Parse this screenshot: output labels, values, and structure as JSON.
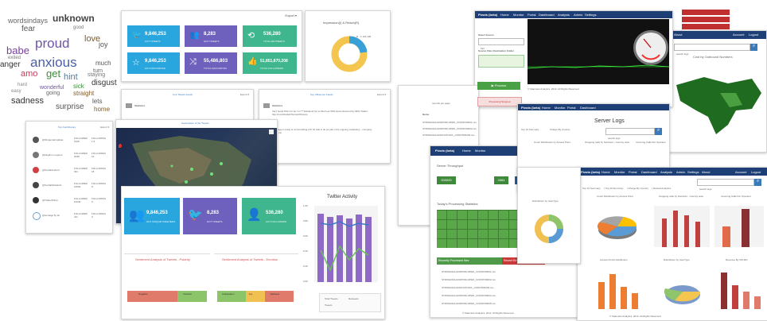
{
  "wordcloud": {
    "words": [
      "wordsindays",
      "unknown",
      "fear",
      "love",
      "proud",
      "babe",
      "anxious",
      "joy",
      "exited",
      "anger",
      "amo",
      "get",
      "hint",
      "much",
      "disgust",
      "turn",
      "staying",
      "sadness",
      "straight",
      "day",
      "lets",
      "surprise",
      "home",
      "sick",
      "wonderful",
      "going",
      "hard",
      "easy",
      "good"
    ]
  },
  "dashboard": {
    "export_label": "Export ▾",
    "tiles": [
      {
        "value": "9,846,253",
        "caption": "HOT TWEETS",
        "color": "#29a6dd"
      },
      {
        "value": "8,283",
        "caption": "HOT TWEETS",
        "color": "#6e60bd"
      },
      {
        "value": "536,280",
        "caption": "TOTAL RETWEETS",
        "color": "#3fb68e"
      },
      {
        "value": "9,846,253",
        "caption": "HOT FAVOURITES",
        "color": "#29a6dd"
      },
      {
        "value": "55,486,803",
        "caption": "TOTAL FAVOURITES",
        "color": "#6e60bd"
      },
      {
        "value": "51,851,870,208",
        "caption": "TOTAL FOLLOWERS",
        "color": "#3fb68e"
      }
    ],
    "donut_title": "Impression(I) & Reach(R)",
    "donut_label": "R - 1,101,1##",
    "live_tweets_title": "Live Tweets Feeds",
    "key_influencer_title": "Key Influencer Feeds",
    "user1": "Statistics",
    "user2": "Statistics",
    "tweet1": "Very Good Pick On: Ex 1-1™ Weekend Up to Much as 30% Here! Ensured by 90% Twitter. http://t.co/AbcdeF/SomeURLHere",
    "tweet2": "Leverage it ready is commanding 2.0/ 10 ads in do as part of its ongoing marketing... company outlet inc.",
    "top_influencer_title": "Top Contributors",
    "influencers": [
      {
        "name": "@thingenderupdate",
        "followers": "FOLLOWER 1328",
        "following": "FOLLOWING 1.6"
      },
      {
        "name": "@blogfrom regions",
        "followers": "FOLLOWER 2038",
        "following": "FOLLOWING 16"
      },
      {
        "name": "@SocialAndroid",
        "followers": "FOLLOWER 391",
        "following": "FOLLOWING 18"
      },
      {
        "name": "@SocialMediaInfo",
        "followers": "FOLLOWER 10000",
        "following": "FOLLOWING 8"
      },
      {
        "name": "@TwitterPolicy",
        "followers": "FOLLOWER 10046",
        "following": "FOLLOWING 9"
      },
      {
        "name": "@socialgo 5y 0u",
        "followers": "FOLLOWER 411",
        "following": "FOLLOWING 9"
      }
    ],
    "map_title": "Geolocation of the Tweets",
    "big_tiles": [
      {
        "value": "9,846,253",
        "caption": "HOT UNIQUE TWEETERS",
        "color": "#29a6dd"
      },
      {
        "value": "8,283",
        "caption": "HOT TWEETS",
        "color": "#6e60bd"
      },
      {
        "value": "536,280",
        "caption": "HOT FOLLOWERS",
        "color": "#3fb68e"
      }
    ],
    "activity_title": "Twitter Activity",
    "activity_yticks": [
      "1.00",
      "0.80",
      "0.60",
      "0.40",
      "0.20",
      "0.00"
    ],
    "activity_legend": [
      "Total Tweets",
      "Retweets",
      "Tweets"
    ],
    "sentiment_polarity_title": "Sentiment Analysis of Tweets - Polarity",
    "sentiment_emotion_title": "Sentiment Analysis of Tweets - Emotion",
    "polarity_labels": [
      "Negative",
      "Positive"
    ],
    "emotion_labels": [
      "Anticipation",
      "Joy",
      "Sadness"
    ]
  },
  "serverlogs": {
    "brand": "Pivots (beta)",
    "nav": [
      "Home",
      "Monitor",
      "Portal",
      "Dashboard",
      "Analysis",
      "Admin",
      "Settings",
      "About"
    ],
    "account": [
      "Account",
      "Logout"
    ],
    "select_source": "Select Source",
    "source_value": "Tail",
    "destination_folder": "Source Files Destination Folder",
    "start_button": "▶ Process",
    "processing_stopped": "Processing Stopped",
    "copyright": "© Statmaxs Analytics, 2014. All Rights Reserved.",
    "records_label": "records per page",
    "name_col": "Name",
    "server_throughput": "Server Throughput",
    "throughput_values": [
      "000000",
      "2684",
      "STOP"
    ],
    "todays_stats": "Today's Processing Statistics",
    "recently_processed": "Recently Processed files",
    "recent_errors": "Recent Erroneous files",
    "file_details": "File Details",
    "files": [
      "STRINGDIALHORPODLOPEN_CONNTR0001.csv",
      "STRINGDIALHORPODLOPEN_CONNTR0002.csv",
      "STRINGDIALHORCUSTHOL_CONNTR0003.csv",
      "STRINGDIALHORPODLOPEN_CONNTR0004.csv",
      "STRINGDIALHORPODLOPEN_CONNTR0005.csv"
    ],
    "server_logs_title": "Server Logs",
    "cost_title": "Cost by Outbound Numbers",
    "search_placeholder": "search logs",
    "breadcrumb": [
      "Top 10 Summary",
      "Top 20 Summary",
      "Charge By Country",
      "Reload Analytics"
    ],
    "chart_titles": [
      "Count Distribution by Access Point",
      "Outgoing calls by Numbers - Country wise",
      "Incoming Calls Per Operator",
      "Distribution by UserType",
      "Outgoing calls by Numbers - Country wise",
      "Incoming Calls For Inception",
      "Access Points Distribution",
      "Distribution by UserType",
      "Revenue By VPLMN"
    ],
    "back_legend": [
      "Accepted",
      "Rejected"
    ]
  }
}
